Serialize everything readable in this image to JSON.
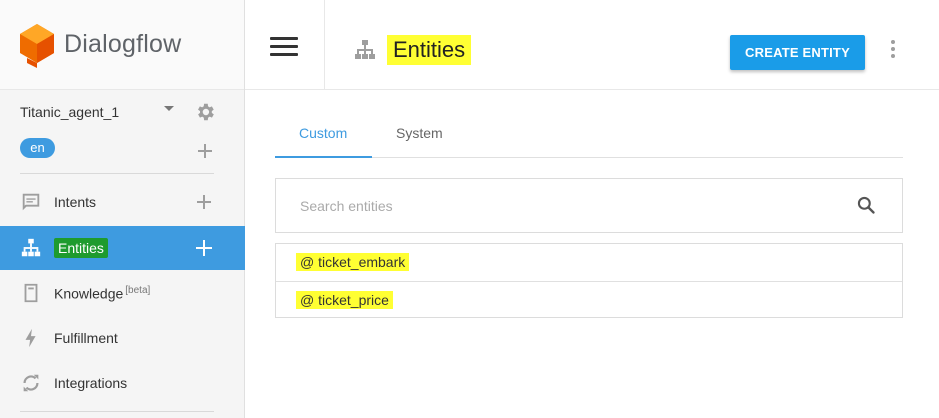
{
  "brand": {
    "name": "Dialogflow"
  },
  "agent": {
    "name": "Titanic_agent_1",
    "language": "en"
  },
  "sidebar": {
    "items": [
      {
        "label": "Intents",
        "icon": "chat-bubble-icon",
        "has_add": true
      },
      {
        "label": "Entities",
        "icon": "hierarchy-icon",
        "has_add": true,
        "active": true
      },
      {
        "label": "Knowledge",
        "beta": "[beta]",
        "icon": "book-icon"
      },
      {
        "label": "Fulfillment",
        "icon": "lightning-icon"
      },
      {
        "label": "Integrations",
        "icon": "sync-icon"
      }
    ]
  },
  "header": {
    "title": "Entities",
    "create_label": "CREATE ENTITY"
  },
  "tabs": [
    {
      "label": "Custom",
      "active": true
    },
    {
      "label": "System",
      "active": false
    }
  ],
  "search": {
    "placeholder": "Search entities",
    "value": ""
  },
  "entities": [
    "@ ticket_embark",
    "@ ticket_price"
  ],
  "colors": {
    "accent": "#3e9be0",
    "create_button": "#1a9ce8",
    "highlight_yellow": "#ffff33",
    "highlight_green": "#1e9b2e"
  }
}
